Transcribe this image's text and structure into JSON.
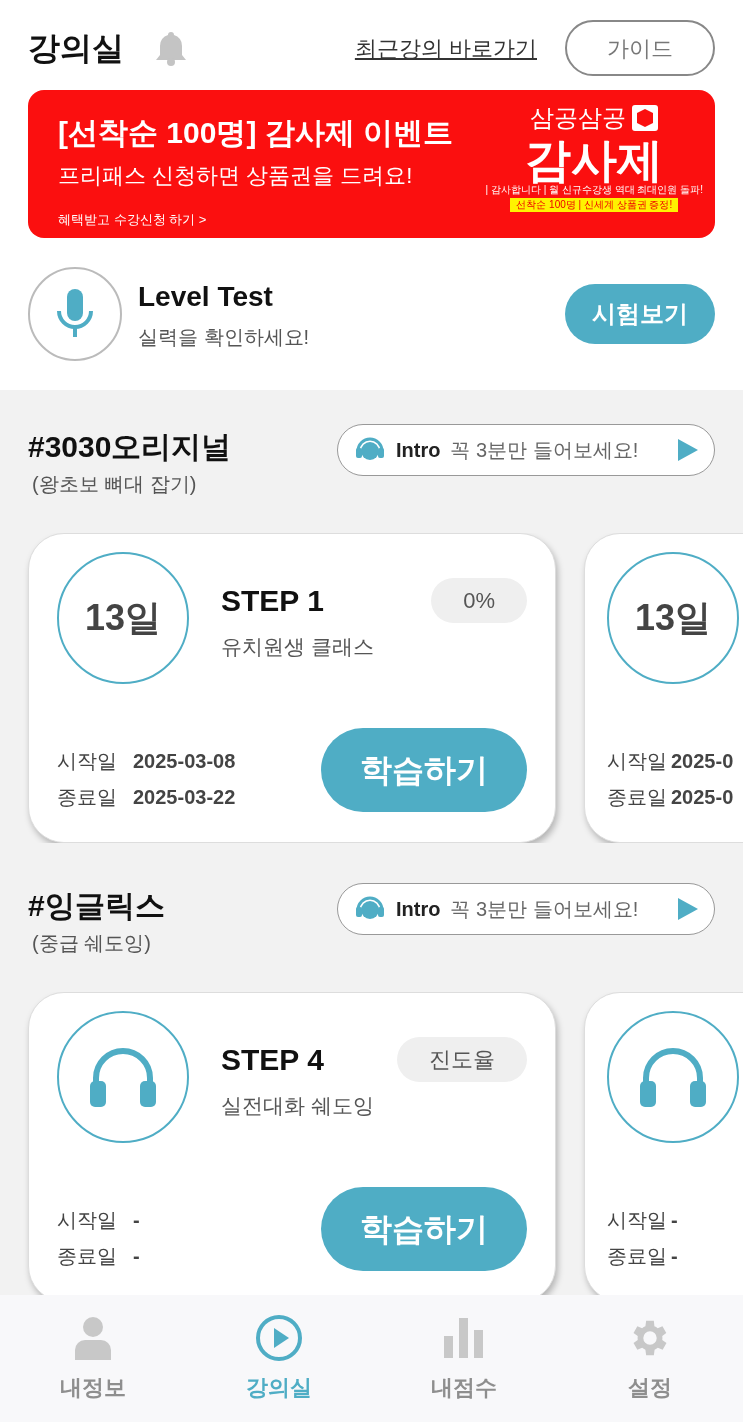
{
  "header": {
    "title": "강의실",
    "link": "최근강의 바로가기",
    "guide_button": "가이드"
  },
  "banner": {
    "headline": "[선착순 100명] 감사제 이벤트",
    "subline": "프리패스 신청하면 상품권을 드려요!",
    "cta": "혜택받고 수강신청 하기 >",
    "brand": "삼공삼공",
    "event": "감사제",
    "small_note": "| 감사합니다 | 월 신규수강생 역대 최대인원 돌파!",
    "tag": "선착순 100명 | 신세계 상품권 증정!"
  },
  "level_test": {
    "title": "Level Test",
    "subtitle": "실력을 확인하세요!",
    "button": "시험보기"
  },
  "courses": [
    {
      "title": "#3030오리지널",
      "subtitle": "(왕초보 뼈대 잡기)",
      "intro": {
        "label": "Intro",
        "text": "꼭 3분만 들어보세요!"
      },
      "cards": [
        {
          "kind": "days",
          "days": "13일",
          "step": "STEP 1",
          "name": "유치원생 클래스",
          "badge": "0%",
          "start_label": "시작일",
          "start": "2025-03-08",
          "end_label": "종료일",
          "end": "2025-03-22",
          "button": "학습하기"
        },
        {
          "kind": "days",
          "days": "13일",
          "start_label": "시작일",
          "start": "2025-0",
          "end_label": "종료일",
          "end": "2025-0"
        }
      ]
    },
    {
      "title": "#잉글릭스",
      "subtitle": "(중급 쉐도잉)",
      "intro": {
        "label": "Intro",
        "text": "꼭 3분만 들어보세요!"
      },
      "cards": [
        {
          "kind": "headphones",
          "step": "STEP 4",
          "name": "실전대화 쉐도잉",
          "badge": "진도율",
          "start_label": "시작일",
          "start": "-",
          "end_label": "종료일",
          "end": "-",
          "button": "학습하기"
        },
        {
          "kind": "headphones",
          "start_label": "시작일",
          "start": "-",
          "end_label": "종료일",
          "end": "-"
        }
      ]
    }
  ],
  "tabs": [
    {
      "label": "내정보",
      "selected": false
    },
    {
      "label": "강의실",
      "selected": true
    },
    {
      "label": "내점수",
      "selected": false
    },
    {
      "label": "설정",
      "selected": false
    }
  ]
}
